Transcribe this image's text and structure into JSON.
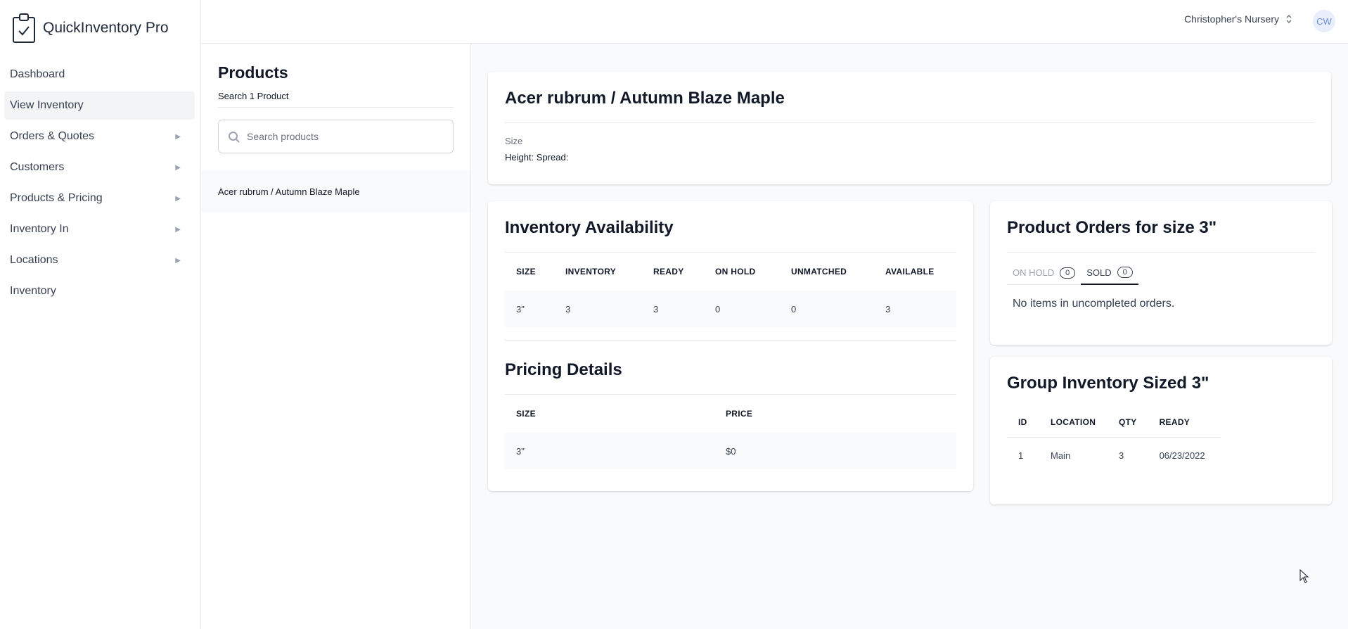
{
  "app": {
    "name": "QuickInventory Pro"
  },
  "sidebar": {
    "items": [
      {
        "label": "Dashboard",
        "expandable": false,
        "active": false
      },
      {
        "label": "View Inventory",
        "expandable": false,
        "active": true
      },
      {
        "label": "Orders & Quotes",
        "expandable": true,
        "active": false
      },
      {
        "label": "Customers",
        "expandable": true,
        "active": false
      },
      {
        "label": "Products & Pricing",
        "expandable": true,
        "active": false
      },
      {
        "label": "Inventory In",
        "expandable": true,
        "active": false
      },
      {
        "label": "Locations",
        "expandable": true,
        "active": false
      },
      {
        "label": "Inventory",
        "expandable": false,
        "active": false
      }
    ]
  },
  "topbar": {
    "org_name": "Christopher's Nursery",
    "avatar_initials": "CW"
  },
  "products": {
    "title": "Products",
    "subtitle": "Search 1 Product",
    "search_placeholder": "Search products",
    "list": [
      "Acer rubrum / Autumn Blaze Maple"
    ]
  },
  "detail": {
    "title": "Acer rubrum / Autumn Blaze Maple",
    "size_label": "Size",
    "size_value": "Height: Spread:"
  },
  "availability": {
    "title": "Inventory Availability",
    "columns": [
      "SIZE",
      "INVENTORY",
      "READY",
      "ON HOLD",
      "UNMATCHED",
      "AVAILABLE"
    ],
    "rows": [
      [
        "3\"",
        "3",
        "3",
        "0",
        "0",
        "3"
      ]
    ]
  },
  "pricing": {
    "title": "Pricing Details",
    "columns": [
      "SIZE",
      "PRICE"
    ],
    "rows": [
      [
        "3\"",
        "$0"
      ]
    ]
  },
  "orders": {
    "title": "Product Orders for size 3\"",
    "tabs": [
      {
        "label": "ON HOLD",
        "count": "0",
        "active": false
      },
      {
        "label": "SOLD",
        "count": "0",
        "active": true
      }
    ],
    "empty_message": "No items in uncompleted orders."
  },
  "group": {
    "title": "Group Inventory Sized 3\"",
    "columns": [
      "ID",
      "LOCATION",
      "QTY",
      "READY"
    ],
    "rows": [
      [
        "1",
        "Main",
        "3",
        "06/23/2022"
      ]
    ]
  },
  "colors": {
    "accent": "#111827",
    "avatar_bg": "#e8eefb",
    "avatar_text": "#6b8fd9"
  }
}
